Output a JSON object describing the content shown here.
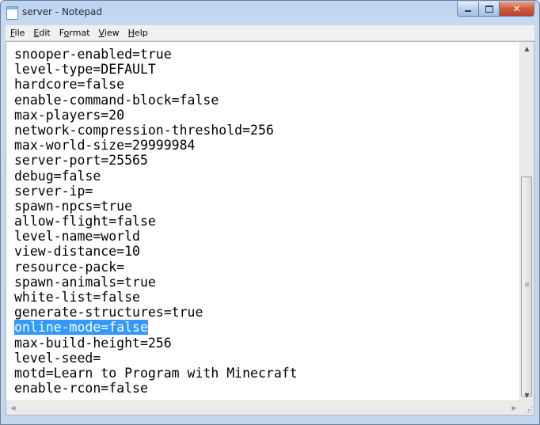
{
  "window": {
    "title": "server - Notepad",
    "icon": "notepad-icon",
    "buttons": {
      "minimize": "minimize-icon",
      "maximize": "maximize-icon",
      "close": "close-icon"
    }
  },
  "menubar": {
    "file": {
      "mnemonic": "F",
      "rest": "ile"
    },
    "edit": {
      "mnemonic": "E",
      "rest": "dit"
    },
    "format": {
      "prefix": "F",
      "mnemonic": "o",
      "rest": "rmat"
    },
    "view": {
      "mnemonic": "V",
      "rest": "iew"
    },
    "help": {
      "mnemonic": "H",
      "rest": "elp"
    }
  },
  "editor": {
    "lines": [
      "snooper-enabled=true",
      "level-type=DEFAULT",
      "hardcore=false",
      "enable-command-block=false",
      "max-players=20",
      "network-compression-threshold=256",
      "max-world-size=29999984",
      "server-port=25565",
      "debug=false",
      "server-ip=",
      "spawn-npcs=true",
      "allow-flight=false",
      "level-name=world",
      "view-distance=10",
      "resource-pack=",
      "spawn-animals=true",
      "white-list=false",
      "generate-structures=true",
      "online-mode=false",
      "max-build-height=256",
      "level-seed=",
      "motd=Learn to Program with Minecraft",
      "enable-rcon=false"
    ],
    "selected_line": "online-mode=false"
  },
  "colors": {
    "selection": "#3399ff",
    "close_button": "#c8482f",
    "titlebar": "#c2d6ee"
  }
}
